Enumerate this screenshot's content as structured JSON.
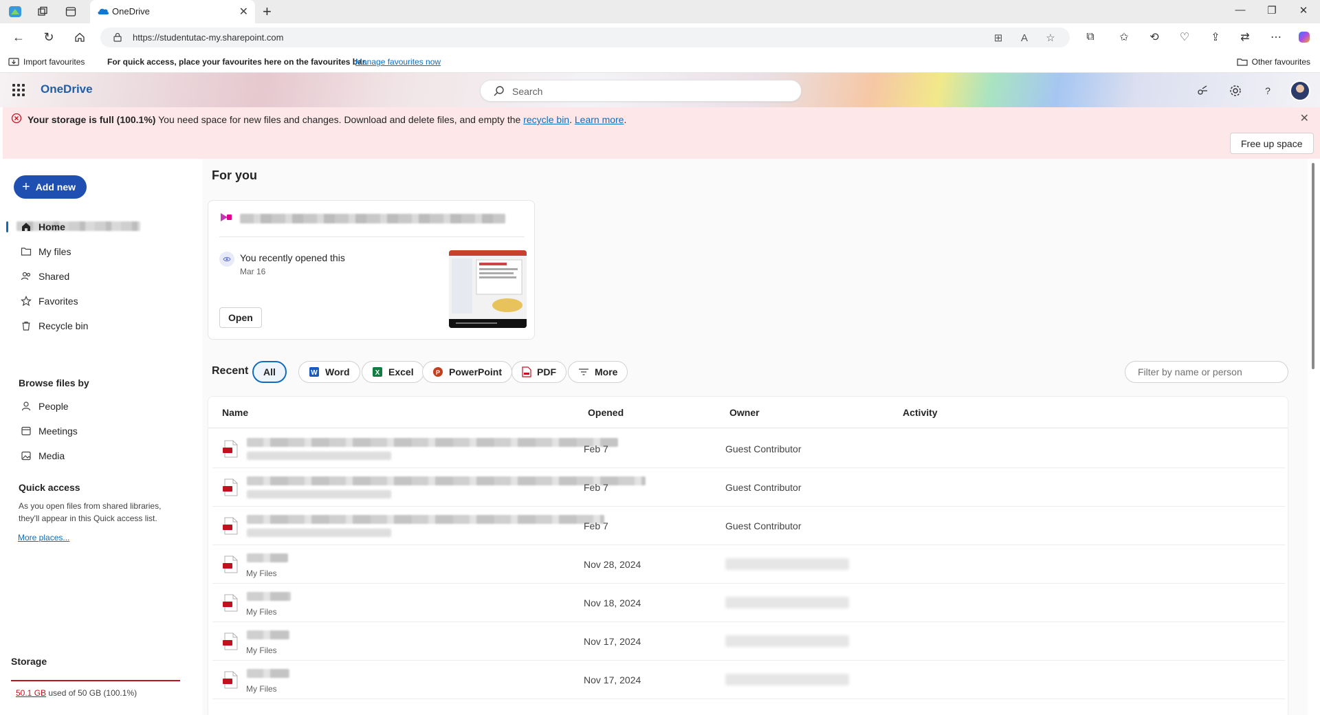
{
  "browser": {
    "tab_title": "OneDrive",
    "url": "https://studentutac-my.sharepoint.com",
    "favbar": {
      "import_label": "Import favourites",
      "hint": "For quick access, place your favourites here on the favourites bar.",
      "manage_link": "Manage favourites now",
      "other_label": "Other favourites"
    }
  },
  "header": {
    "app_name": "OneDrive",
    "search_placeholder": "Search"
  },
  "banner": {
    "bold_text": "Your storage is full (100.1%)",
    "message": " You need space for new files and changes. Download and delete files, and empty the ",
    "recycle_link": "recycle bin",
    "after_link": ". ",
    "learn_more": "Learn more",
    "end": ".",
    "free_up_button": "Free up space"
  },
  "sidebar": {
    "add_new_label": "Add new",
    "items": [
      {
        "label": "Home",
        "icon": "home-icon"
      },
      {
        "label": "My files",
        "icon": "folder-icon"
      },
      {
        "label": "Shared",
        "icon": "people-icon"
      },
      {
        "label": "Favorites",
        "icon": "star-icon"
      },
      {
        "label": "Recycle bin",
        "icon": "trash-icon"
      }
    ],
    "browse_heading": "Browse files by",
    "browse_items": [
      {
        "label": "People",
        "icon": "person-icon"
      },
      {
        "label": "Meetings",
        "icon": "calendar-icon"
      },
      {
        "label": "Media",
        "icon": "image-icon"
      }
    ],
    "quick_access_heading": "Quick access",
    "quick_access_desc": "As you open files from shared libraries, they'll appear in this Quick access list.",
    "more_places": "More places...",
    "storage_heading": "Storage",
    "storage_used": "50.1 GB",
    "storage_rest": " used of 50 GB (100.1%)"
  },
  "for_you": {
    "title": "For you",
    "card": {
      "activity": "You recently opened this",
      "date": "Mar 16",
      "open_button": "Open"
    }
  },
  "recent": {
    "label": "Recent",
    "filters": [
      "All",
      "Word",
      "Excel",
      "PowerPoint",
      "PDF",
      "More"
    ],
    "filter_placeholder": "Filter by name or person",
    "columns": [
      "Name",
      "Opened",
      "Owner",
      "Activity"
    ],
    "rows": [
      {
        "location": "",
        "opened": "Feb 7",
        "owner": "Guest Contributor"
      },
      {
        "location": "",
        "opened": "Feb 7",
        "owner": "Guest Contributor"
      },
      {
        "location": "",
        "opened": "Feb 7",
        "owner": "Guest Contributor"
      },
      {
        "location": "My Files",
        "opened": "Nov 28, 2024",
        "owner": ""
      },
      {
        "location": "My Files",
        "opened": "Nov 18, 2024",
        "owner": ""
      },
      {
        "location": "My Files",
        "opened": "Nov 17, 2024",
        "owner": ""
      },
      {
        "location": "My Files",
        "opened": "Nov 17, 2024",
        "owner": ""
      }
    ]
  },
  "colors": {
    "accent": "#0f6cbd",
    "add_new_bg": "#1f4fb1",
    "banner_bg": "#fde7e9",
    "error": "#c50f1f"
  }
}
